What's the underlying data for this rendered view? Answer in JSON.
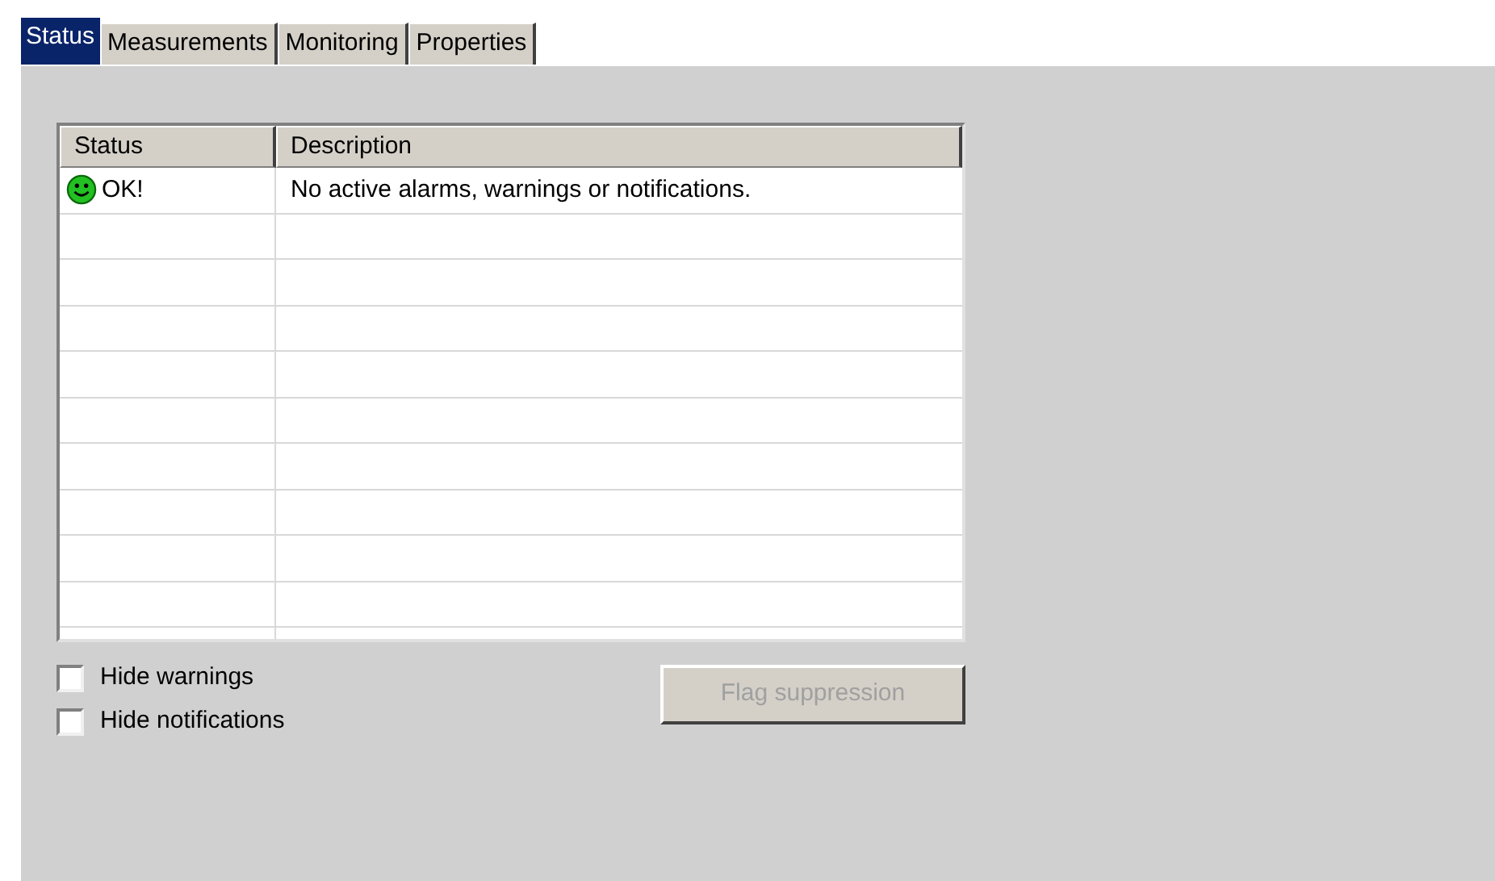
{
  "tabs": [
    {
      "label": "Status",
      "selected": true
    },
    {
      "label": "Measurements",
      "selected": false
    },
    {
      "label": "Monitoring",
      "selected": false
    },
    {
      "label": "Properties",
      "selected": false
    }
  ],
  "table": {
    "columns": [
      "Status",
      "Description"
    ],
    "rows": [
      {
        "status": "OK!",
        "description": "No active alarms, warnings or notifications."
      }
    ]
  },
  "options": [
    {
      "label": "Hide warnings",
      "checked": false
    },
    {
      "label": "Hide notifications",
      "checked": false
    }
  ],
  "flag_button": {
    "label": "Flag suppression",
    "disabled": true
  }
}
